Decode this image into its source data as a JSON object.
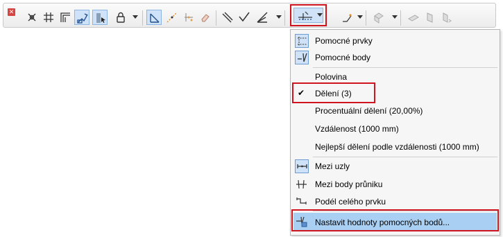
{
  "toolbar": {
    "close_glyph": "✕",
    "buttons": [
      {
        "name": "intersection-snap-icon"
      },
      {
        "name": "grid-snap-icon"
      },
      {
        "name": "corner-snap-icon"
      },
      {
        "name": "trace-reference-icon"
      },
      {
        "name": "pointer-select-icon"
      },
      {
        "name": "padlock-icon"
      },
      {
        "name": "guide-lines-icon"
      },
      {
        "name": "dashed-line-point-icon"
      },
      {
        "name": "scatter-points-icon"
      },
      {
        "name": "eraser-icon"
      },
      {
        "name": "parallel-lines-icon"
      },
      {
        "name": "angle-check-icon"
      },
      {
        "name": "angle-bisector-icon"
      },
      {
        "name": "special-snap-points-icon"
      },
      {
        "name": "trace-arrow-icon"
      },
      {
        "name": "cube-faces-icon"
      },
      {
        "name": "plane-icon"
      },
      {
        "name": "panel-icon"
      },
      {
        "name": "rotate-panel-icon"
      }
    ]
  },
  "menu": {
    "items": [
      {
        "label": "Pomocné prvky"
      },
      {
        "label": "Pomocné body"
      },
      {
        "label": "Polovina"
      },
      {
        "label": "Dělení (3)",
        "checked": true
      },
      {
        "label": "Procentuální dělení (20,00%)"
      },
      {
        "label": "Vzdálenost (1000 mm)"
      },
      {
        "label": "Nejlepší dělení podle vzdálenosti (1000 mm)"
      },
      {
        "label": "Mezi uzly"
      },
      {
        "label": "Mezi body průniku"
      },
      {
        "label": "Podél celého prvku"
      },
      {
        "label": "Nastavit hodnoty pomocných bodů..."
      }
    ],
    "check_glyph": "✔"
  },
  "colors": {
    "highlight": "#d0141f",
    "pressed_bg": "#cfe2f7",
    "hover_bg": "#a9cff2"
  }
}
